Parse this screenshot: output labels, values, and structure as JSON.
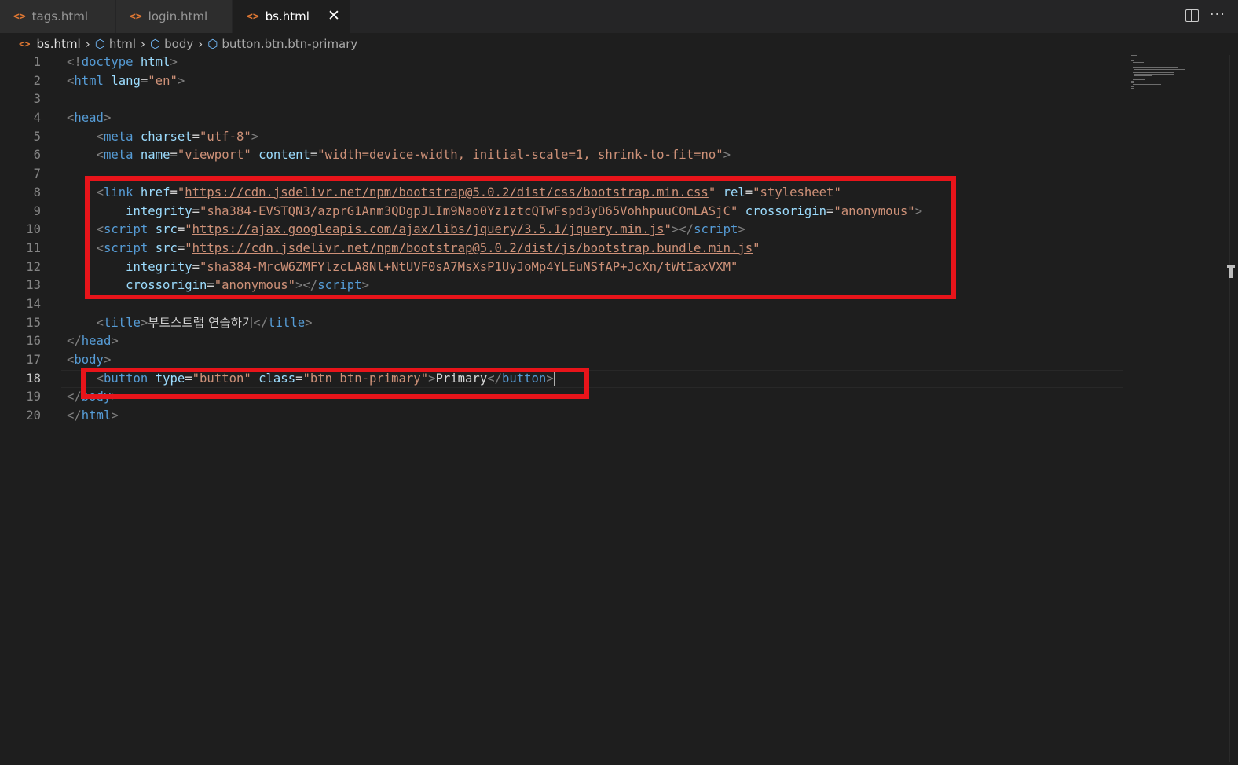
{
  "tabs": [
    {
      "label": "tags.html",
      "active": false
    },
    {
      "label": "login.html",
      "active": false
    },
    {
      "label": "bs.html",
      "active": true,
      "close_icon": "close-icon"
    }
  ],
  "editor_actions": {
    "split_icon": "split-editor-icon",
    "more_icon": "more-actions-icon"
  },
  "breadcrumb": [
    {
      "label": "bs.html",
      "icon": "html-file-icon"
    },
    {
      "label": "html",
      "icon": "symbol-element-icon"
    },
    {
      "label": "body",
      "icon": "symbol-element-icon"
    },
    {
      "label": "button.btn.btn-primary",
      "icon": "symbol-element-icon"
    }
  ],
  "editor": {
    "active_line": 18,
    "lines": [
      {
        "n": "1",
        "code": [
          [
            "br",
            "<!"
          ],
          [
            "tag",
            "doctype"
          ],
          [
            "txt",
            " "
          ],
          [
            "attr",
            "html"
          ],
          [
            "br",
            ">"
          ]
        ]
      },
      {
        "n": "2",
        "code": [
          [
            "br",
            "<"
          ],
          [
            "tag",
            "html"
          ],
          [
            "txt",
            " "
          ],
          [
            "attr",
            "lang"
          ],
          [
            "eq",
            "="
          ],
          [
            "str",
            "\"en\""
          ],
          [
            "br",
            ">"
          ]
        ]
      },
      {
        "n": "3",
        "code": []
      },
      {
        "n": "4",
        "code": [
          [
            "br",
            "<"
          ],
          [
            "tag",
            "head"
          ],
          [
            "br",
            ">"
          ]
        ]
      },
      {
        "n": "5",
        "code": [
          [
            "txt",
            "    "
          ],
          [
            "br",
            "<"
          ],
          [
            "tag",
            "meta"
          ],
          [
            "txt",
            " "
          ],
          [
            "attr",
            "charset"
          ],
          [
            "eq",
            "="
          ],
          [
            "str",
            "\"utf-8\""
          ],
          [
            "br",
            ">"
          ]
        ]
      },
      {
        "n": "6",
        "code": [
          [
            "txt",
            "    "
          ],
          [
            "br",
            "<"
          ],
          [
            "tag",
            "meta"
          ],
          [
            "txt",
            " "
          ],
          [
            "attr",
            "name"
          ],
          [
            "eq",
            "="
          ],
          [
            "str",
            "\"viewport\""
          ],
          [
            "txt",
            " "
          ],
          [
            "attr",
            "content"
          ],
          [
            "eq",
            "="
          ],
          [
            "str",
            "\"width=device-width, initial-scale=1, shrink-to-fit=no\""
          ],
          [
            "br",
            ">"
          ]
        ]
      },
      {
        "n": "7",
        "code": []
      },
      {
        "n": "8",
        "code": [
          [
            "txt",
            "    "
          ],
          [
            "br",
            "<"
          ],
          [
            "tag",
            "link"
          ],
          [
            "txt",
            " "
          ],
          [
            "attr",
            "href"
          ],
          [
            "eq",
            "="
          ],
          [
            "str",
            "\""
          ],
          [
            "url",
            "https://cdn.jsdelivr.net/npm/bootstrap@5.0.2/dist/css/bootstrap.min.css"
          ],
          [
            "str",
            "\""
          ],
          [
            "txt",
            " "
          ],
          [
            "attr",
            "rel"
          ],
          [
            "eq",
            "="
          ],
          [
            "str",
            "\"stylesheet\""
          ]
        ]
      },
      {
        "n": "9",
        "code": [
          [
            "txt",
            "        "
          ],
          [
            "attr",
            "integrity"
          ],
          [
            "eq",
            "="
          ],
          [
            "str",
            "\"sha384-EVSTQN3/azprG1Anm3QDgpJLIm9Nao0Yz1ztcQTwFspd3yD65VohhpuuCOmLASjC\""
          ],
          [
            "txt",
            " "
          ],
          [
            "attr",
            "crossorigin"
          ],
          [
            "eq",
            "="
          ],
          [
            "str",
            "\"anonymous\""
          ],
          [
            "br",
            ">"
          ]
        ]
      },
      {
        "n": "10",
        "code": [
          [
            "txt",
            "    "
          ],
          [
            "br",
            "<"
          ],
          [
            "tag",
            "script"
          ],
          [
            "txt",
            " "
          ],
          [
            "attr",
            "src"
          ],
          [
            "eq",
            "="
          ],
          [
            "str",
            "\""
          ],
          [
            "url",
            "https://ajax.googleapis.com/ajax/libs/jquery/3.5.1/jquery.min.js"
          ],
          [
            "str",
            "\""
          ],
          [
            "br",
            "></"
          ],
          [
            "tag",
            "script"
          ],
          [
            "br",
            ">"
          ]
        ]
      },
      {
        "n": "11",
        "code": [
          [
            "txt",
            "    "
          ],
          [
            "br",
            "<"
          ],
          [
            "tag",
            "script"
          ],
          [
            "txt",
            " "
          ],
          [
            "attr",
            "src"
          ],
          [
            "eq",
            "="
          ],
          [
            "str",
            "\""
          ],
          [
            "url",
            "https://cdn.jsdelivr.net/npm/bootstrap@5.0.2/dist/js/bootstrap.bundle.min.js"
          ],
          [
            "str",
            "\""
          ]
        ]
      },
      {
        "n": "12",
        "code": [
          [
            "txt",
            "        "
          ],
          [
            "attr",
            "integrity"
          ],
          [
            "eq",
            "="
          ],
          [
            "str",
            "\"sha384-MrcW6ZMFYlzcLA8Nl+NtUVF0sA7MsXsP1UyJoMp4YLEuNSfAP+JcXn/tWtIaxVXM\""
          ]
        ]
      },
      {
        "n": "13",
        "code": [
          [
            "txt",
            "        "
          ],
          [
            "attr",
            "crossorigin"
          ],
          [
            "eq",
            "="
          ],
          [
            "str",
            "\"anonymous\""
          ],
          [
            "br",
            "></"
          ],
          [
            "tag",
            "script"
          ],
          [
            "br",
            ">"
          ]
        ]
      },
      {
        "n": "14",
        "code": []
      },
      {
        "n": "15",
        "code": [
          [
            "txt",
            "    "
          ],
          [
            "br",
            "<"
          ],
          [
            "tag",
            "title"
          ],
          [
            "br",
            ">"
          ],
          [
            "korean",
            "부트스트랩 연습하기"
          ],
          [
            "br",
            "</"
          ],
          [
            "tag",
            "title"
          ],
          [
            "br",
            ">"
          ]
        ]
      },
      {
        "n": "16",
        "code": [
          [
            "br",
            "</"
          ],
          [
            "tag",
            "head"
          ],
          [
            "br",
            ">"
          ]
        ]
      },
      {
        "n": "17",
        "code": [
          [
            "br",
            "<"
          ],
          [
            "tag",
            "body"
          ],
          [
            "br",
            ">"
          ]
        ]
      },
      {
        "n": "18",
        "code": [
          [
            "txt",
            "    "
          ],
          [
            "br",
            "<"
          ],
          [
            "tag",
            "button"
          ],
          [
            "txt",
            " "
          ],
          [
            "attr",
            "type"
          ],
          [
            "eq",
            "="
          ],
          [
            "str",
            "\"button\""
          ],
          [
            "txt",
            " "
          ],
          [
            "attr",
            "class"
          ],
          [
            "eq",
            "="
          ],
          [
            "str",
            "\"btn btn-primary\""
          ],
          [
            "br",
            ">"
          ],
          [
            "txt",
            "Primary"
          ],
          [
            "br",
            "</"
          ],
          [
            "tag",
            "button"
          ],
          [
            "br",
            ">"
          ],
          [
            "cursor",
            ""
          ]
        ]
      },
      {
        "n": "19",
        "code": [
          [
            "br",
            "</"
          ],
          [
            "tag",
            "body"
          ],
          [
            "br",
            ">"
          ]
        ]
      },
      {
        "n": "20",
        "code": [
          [
            "br",
            "</"
          ],
          [
            "tag",
            "html"
          ],
          [
            "br",
            ">"
          ]
        ]
      }
    ]
  },
  "annotation_color": "#e8141a"
}
